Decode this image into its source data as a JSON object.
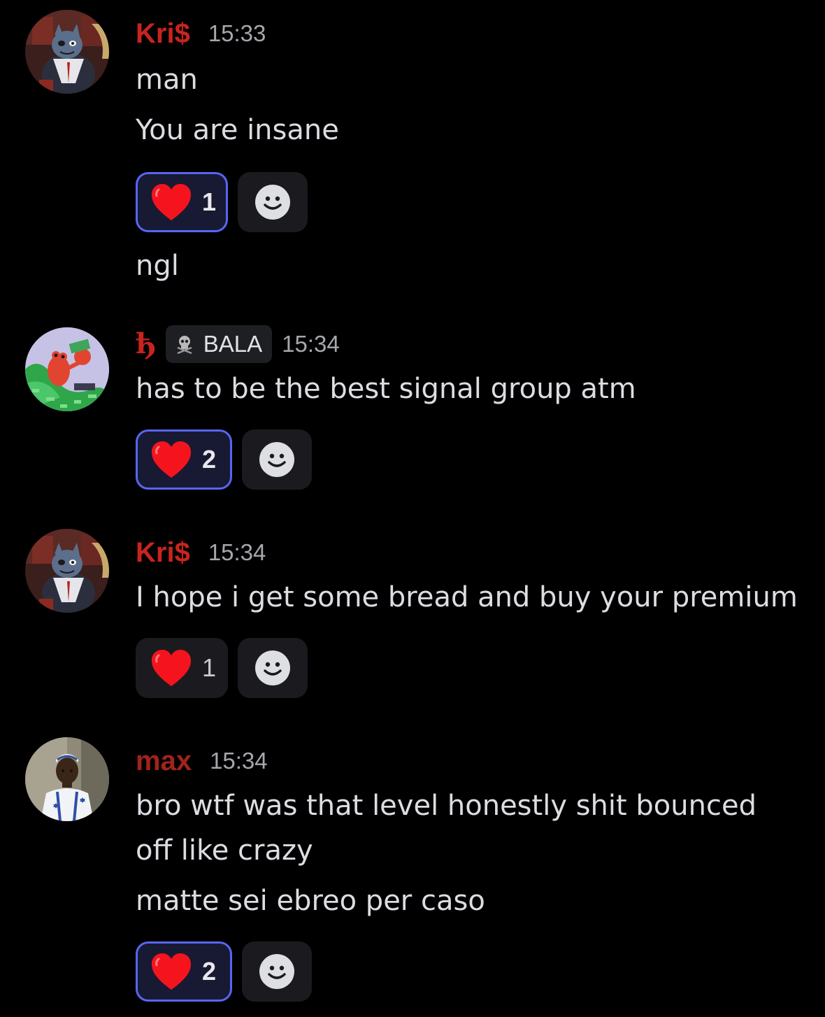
{
  "colors": {
    "username_red": "#c8241e",
    "max_red": "#a1231c",
    "accent_blue": "#5865f2",
    "background": "#000000"
  },
  "messages": [
    {
      "author": "Kri$",
      "timestamp": "15:33",
      "avatar_icon": "cat-avatar-icon",
      "lines": [
        "man",
        "You are insane"
      ],
      "reactions": {
        "emoji": "heart-icon",
        "count": "1",
        "active": true
      },
      "after_lines": [
        "ngl"
      ]
    },
    {
      "author_glyph": "ђ",
      "role_tag": "BALA",
      "timestamp": "15:34",
      "avatar_icon": "crab-money-avatar-icon",
      "lines": [
        "has to be the best signal group atm"
      ],
      "reactions": {
        "emoji": "heart-icon",
        "count": "2",
        "active": true
      }
    },
    {
      "author": "Kri$",
      "timestamp": "15:34",
      "avatar_icon": "cat-avatar-icon",
      "lines": [
        "I hope i get some bread and buy your premium"
      ],
      "reactions": {
        "emoji": "heart-icon",
        "count": "1",
        "active": false
      }
    },
    {
      "author": "max",
      "timestamp": "15:34",
      "avatar_icon": "child-photo-avatar-icon",
      "lines": [
        "bro wtf was that level honestly shit bounced",
        "off like crazy",
        "matte sei ebreo per caso"
      ],
      "reactions": {
        "emoji": "heart-icon",
        "count": "2",
        "active": true
      }
    }
  ]
}
